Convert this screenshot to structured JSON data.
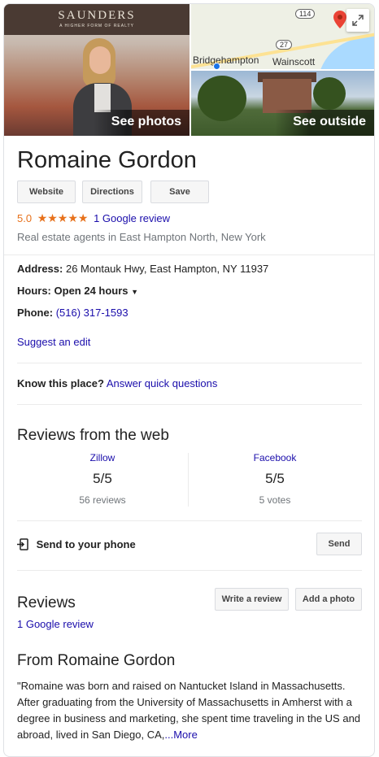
{
  "images": {
    "main_brand": "SAUNDERS",
    "main_tagline": "A HIGHER FORM OF REALTY",
    "see_photos": "See photos",
    "see_outside": "See outside",
    "map": {
      "route_114": "114",
      "route_27": "27",
      "town_1": "Bridgehampton",
      "town_2": "Wainscott",
      "expand_icon": "expand-icon"
    }
  },
  "title": "Romaine Gordon",
  "buttons": {
    "website": "Website",
    "directions": "Directions",
    "save": "Save"
  },
  "rating": {
    "value": "5.0",
    "stars": "★★★★★",
    "star_count": 5,
    "review_link": "1 Google review"
  },
  "category": "Real estate agents in East Hampton North, New York",
  "details": {
    "address_label": "Address:",
    "address": "26 Montauk Hwy, East Hampton, NY 11937",
    "hours_label": "Hours:",
    "hours": "Open 24 hours",
    "phone_label": "Phone:",
    "phone": "(516) 317-1593",
    "suggest_edit": "Suggest an edit"
  },
  "know_place": {
    "label": "Know this place?",
    "link": "Answer quick questions"
  },
  "web_reviews": {
    "title": "Reviews from the web",
    "items": [
      {
        "source": "Zillow",
        "score": "5/5",
        "count": "56 reviews"
      },
      {
        "source": "Facebook",
        "score": "5/5",
        "count": "5 votes"
      }
    ]
  },
  "send_phone": {
    "label": "Send to your phone",
    "button": "Send"
  },
  "reviews": {
    "title": "Reviews",
    "write": "Write a review",
    "add_photo": "Add a photo",
    "link": "1 Google review"
  },
  "from": {
    "title": "From Romaine Gordon",
    "text": "\"Romaine was born and raised on Nantucket Island in Massachusetts. After graduating from the University of Massachusetts in Amherst with a degree in business and marketing, she spent time traveling in the US and abroad, lived in San Diego, CA,",
    "more": "...More"
  },
  "colors": {
    "link": "#1a0dab",
    "star": "#e7711b",
    "pin": "#ea4335"
  }
}
